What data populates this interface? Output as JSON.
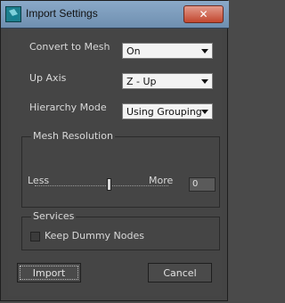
{
  "window": {
    "title": "Import Settings",
    "close_label": "✕"
  },
  "settings": {
    "convert_to_mesh": {
      "label": "Convert to Mesh",
      "value": "On"
    },
    "up_axis": {
      "label": "Up Axis",
      "value": "Z - Up"
    },
    "hierarchy_mode": {
      "label": "Hierarchy Mode",
      "value": "Using Grouping"
    }
  },
  "mesh_resolution": {
    "group_label": "Mesh Resolution",
    "value": "0",
    "min_label": "Less",
    "max_label": "More",
    "slider_fraction": 0.55
  },
  "services": {
    "group_label": "Services",
    "keep_dummy_nodes": {
      "label": "Keep Dummy Nodes",
      "checked": false
    }
  },
  "buttons": {
    "import": "Import",
    "cancel": "Cancel"
  }
}
